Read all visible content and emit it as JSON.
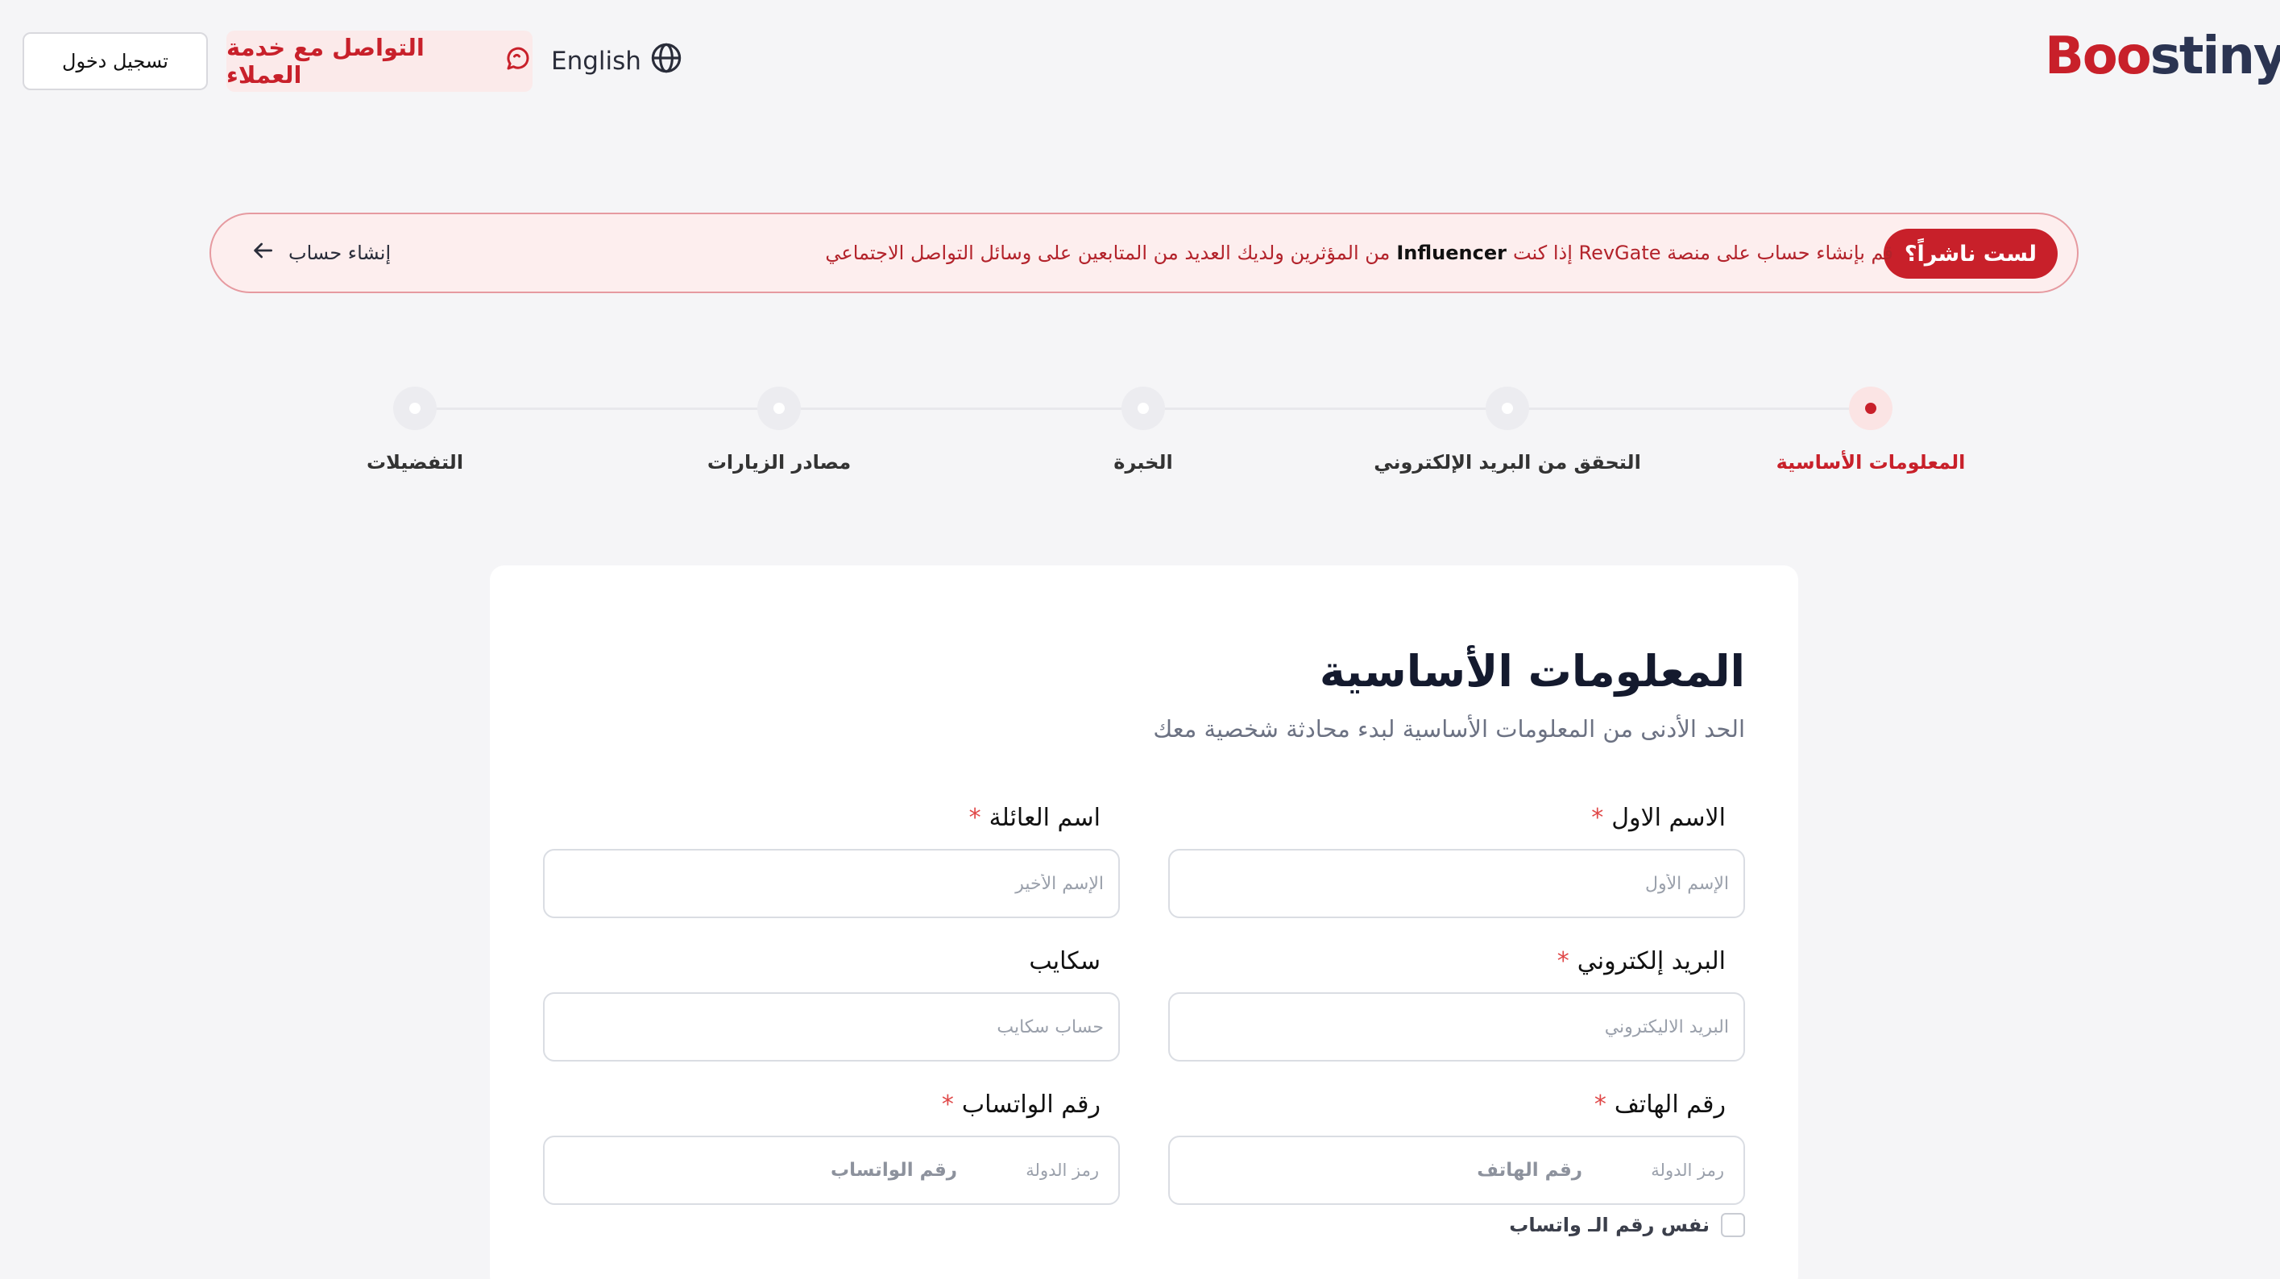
{
  "header": {
    "login_label": "تسجيل دخول",
    "support_label": "التواصل مع خدمة العملاء",
    "language_label": "English",
    "logo": {
      "text_b": "B",
      "text_oo": "oo",
      "text_rest": "stiny"
    }
  },
  "banner": {
    "badge": "لست ناشراً؟",
    "text_part1": "قم بإنشاء حساب على منصة RevGate إذا كنت",
    "text_bold": "Influencer",
    "text_part2": "من المؤثرين ولديك العديد من المتابعين على وسائل التواصل الاجتماعي",
    "link_label": "إنشاء حساب"
  },
  "steps": [
    {
      "label": "المعلومات الأساسية",
      "active": true
    },
    {
      "label": "التحقق من البريد الإلكتروني",
      "active": false
    },
    {
      "label": "الخبرة",
      "active": false
    },
    {
      "label": "مصادر الزيارات",
      "active": false
    },
    {
      "label": "التفضيلات",
      "active": false
    }
  ],
  "form": {
    "title": "المعلومات الأساسية",
    "subtitle": "الحد الأدنى من المعلومات الأساسية لبدء محادثة شخصية معك",
    "required_mark": "*",
    "first_name": {
      "label": "الاسم الاول",
      "placeholder": "الإسم الأول"
    },
    "last_name": {
      "label": "اسم العائلة",
      "placeholder": "الإسم الأخير"
    },
    "email": {
      "label": "البريد إلكتروني",
      "placeholder": "البريد الاليكتروني"
    },
    "skype": {
      "label": "سكايب",
      "placeholder": "حساب سكايب"
    },
    "phone": {
      "label": "رقم الهاتف",
      "code_placeholder": "رمز الدولة",
      "number_placeholder": "رقم الهاتف"
    },
    "whatsapp": {
      "label": "رقم الواتساب",
      "code_placeholder": "رمز الدولة",
      "number_placeholder": "رقم الواتساب"
    },
    "same_number_label": "نفس رقم الـ واتساب"
  },
  "colors": {
    "accent": "#c8202a",
    "background": "#f5f5f7",
    "navy": "#2b3452"
  }
}
